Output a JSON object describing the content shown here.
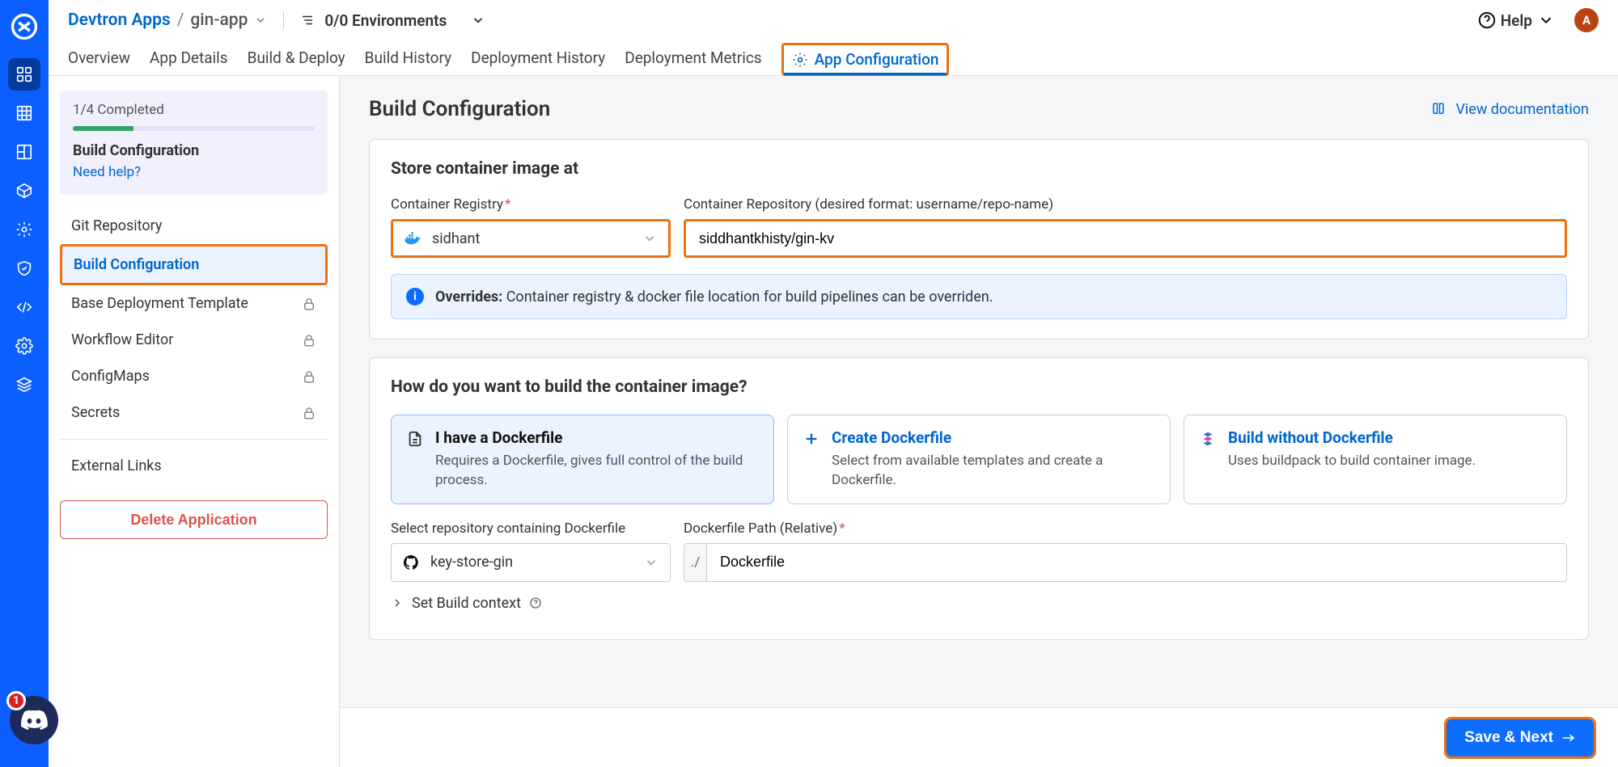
{
  "breadcrumb": {
    "root": "Devtron Apps",
    "app": "gin-app"
  },
  "env_summary": "0/0 Environments",
  "help_label": "Help",
  "avatar_initial": "A",
  "tabs": {
    "overview": "Overview",
    "app_details": "App Details",
    "build_deploy": "Build & Deploy",
    "build_history": "Build History",
    "deployment_history": "Deployment History",
    "deployment_metrics": "Deployment Metrics",
    "app_configuration": "App Configuration"
  },
  "progress": {
    "label": "1/4 Completed",
    "title": "Build Configuration",
    "help": "Need help?"
  },
  "nav": {
    "git_repository": "Git Repository",
    "build_configuration": "Build Configuration",
    "base_deployment_template": "Base Deployment Template",
    "workflow_editor": "Workflow Editor",
    "configmaps": "ConfigMaps",
    "secrets": "Secrets",
    "external_links": "External Links"
  },
  "delete_label": "Delete Application",
  "page": {
    "title": "Build Configuration",
    "doc_link": "View documentation"
  },
  "store": {
    "heading": "Store container image at",
    "registry_label": "Container Registry",
    "registry_value": "sidhant",
    "repo_label": "Container Repository (desired format: username/repo-name)",
    "repo_value": "siddhantkhisty/gin-kv",
    "override_strong": "Overrides:",
    "override_text": " Container registry & docker file location for build pipelines can be overriden."
  },
  "build": {
    "heading": "How do you want to build the container image?",
    "opt1_title": "I have a Dockerfile",
    "opt1_desc": "Requires a Dockerfile, gives full control of the build process.",
    "opt2_title": "Create Dockerfile",
    "opt2_desc": "Select from available templates and create a Dockerfile.",
    "opt3_title": "Build without Dockerfile",
    "opt3_desc": "Uses buildpack to build container image.",
    "repo_label": "Select repository containing Dockerfile",
    "repo_value": "key-store-gin",
    "path_label": "Dockerfile Path (Relative)",
    "path_prefix": "./",
    "path_value": "Dockerfile",
    "set_context": "Set Build context"
  },
  "save_label": "Save & Next",
  "discord_badge": "1"
}
